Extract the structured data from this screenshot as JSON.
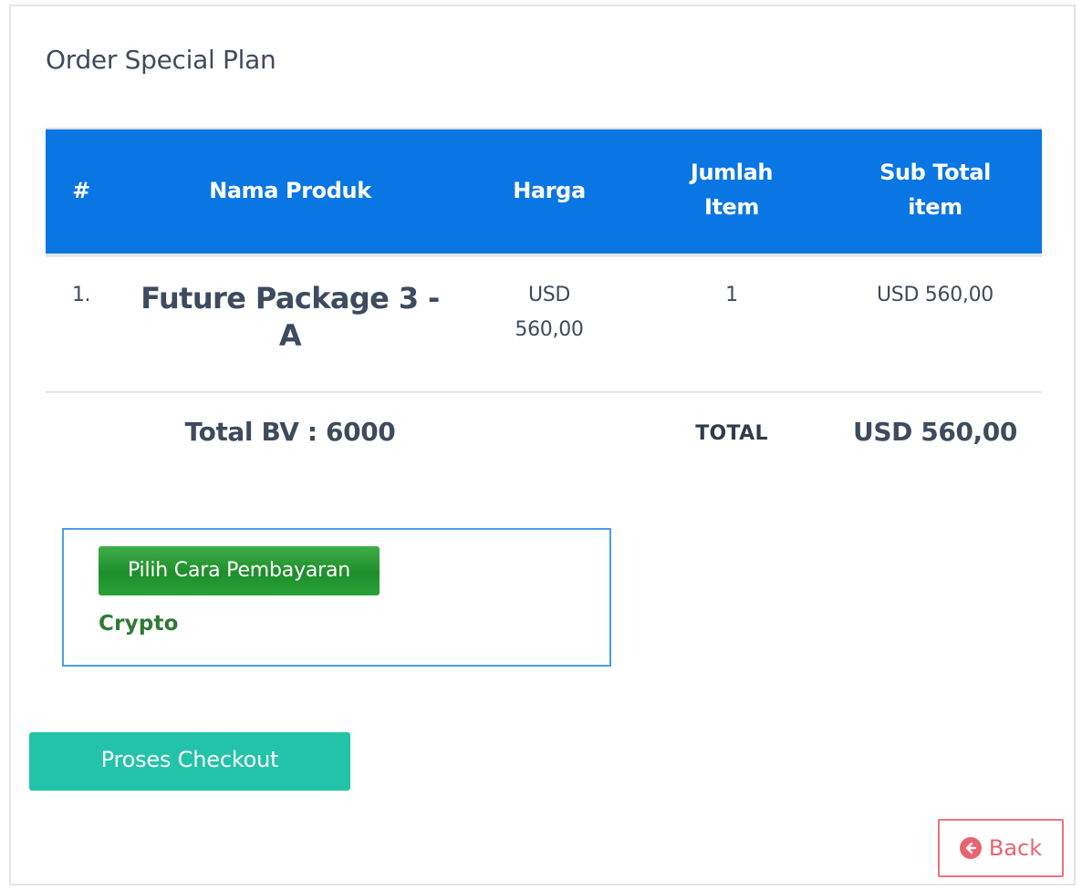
{
  "page_title": "Order Special Plan",
  "table": {
    "headers": {
      "index": "#",
      "product": "Nama Produk",
      "price": "Harga",
      "qty_line1": "Jumlah",
      "qty_line2": "Item",
      "subtotal_line1": "Sub Total",
      "subtotal_line2": "item"
    },
    "rows": [
      {
        "index": "1.",
        "product_line1": "Future Package 3 -",
        "product_line2": "A",
        "price_line1": "USD",
        "price_line2": "560,00",
        "qty": "1",
        "subtotal": "USD 560,00"
      }
    ],
    "footer": {
      "total_bv": "Total BV : 6000",
      "total_label": "TOTAL",
      "total_value": "USD 560,00"
    }
  },
  "payment": {
    "button_label": "Pilih Cara Pembayaran",
    "selected_method": "Crypto"
  },
  "checkout_label": "Proses Checkout",
  "back_label": "Back",
  "colors": {
    "header_bg": "#0a76e4",
    "checkout_bg": "#22c3a8",
    "payment_btn": "#28a745",
    "back_color": "#e8646e",
    "crypto_text": "#2f7a36"
  },
  "icons": {
    "back": "arrow-circle-left-icon"
  }
}
